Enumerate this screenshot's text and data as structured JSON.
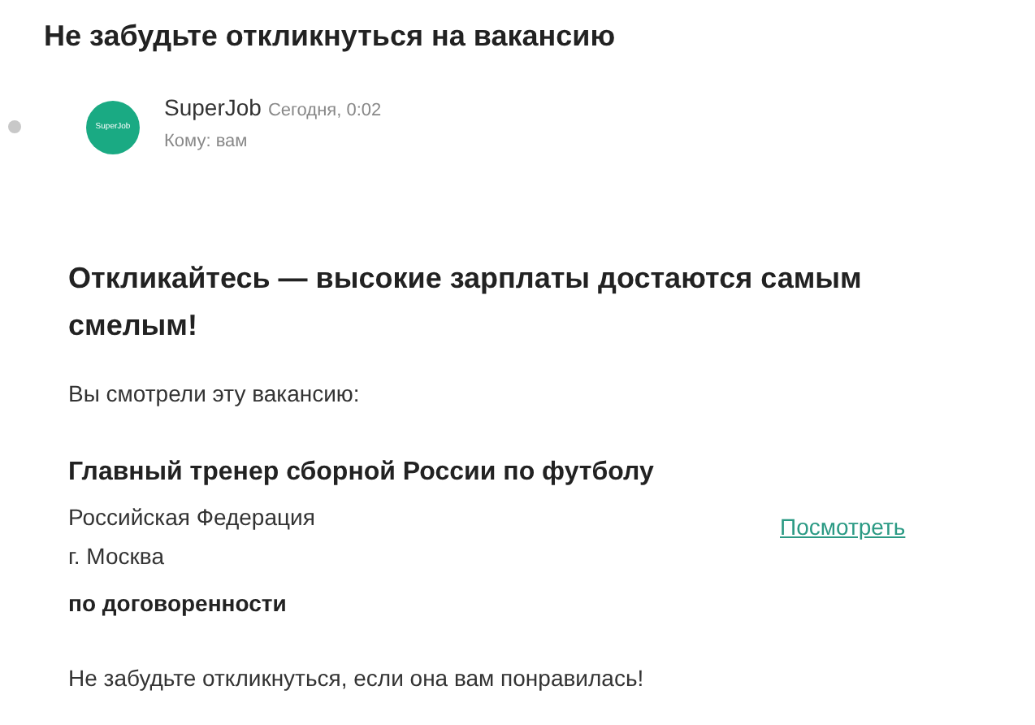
{
  "subject": "Не забудьте откликнуться на вакансию",
  "message": {
    "unread": true,
    "logo_text": "SuperJob",
    "sender": "SuperJob",
    "date": "Сегодня, 0:02",
    "recipient": "Кому: вам"
  },
  "body": {
    "heading": "Откликайтесь — высокие зарплаты достаются самым смелым!",
    "intro": "Вы смотрели эту вакансию:",
    "vacancy": {
      "title": "Главный тренер сборной России по футболу",
      "region": "Российская Федерация",
      "city": "г. Москва",
      "salary": "по договоренности",
      "link": "Посмотреть"
    },
    "outro": "Не забудьте откликнуться, если она вам понравилась!"
  }
}
